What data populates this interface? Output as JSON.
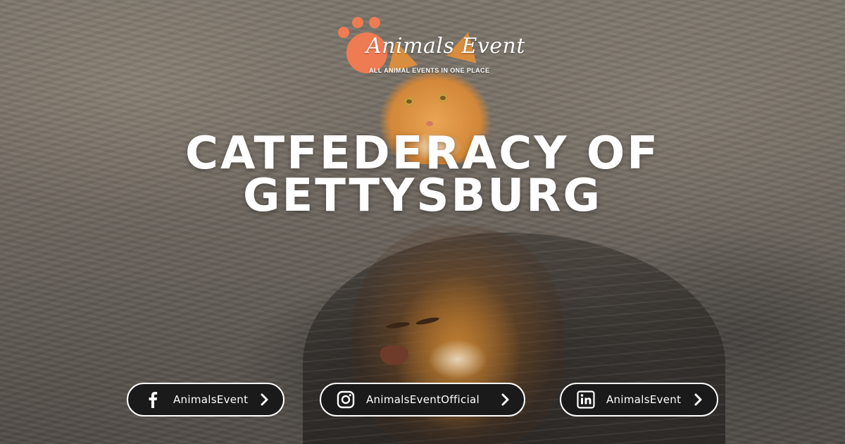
{
  "logo": {
    "title": "Animals Event",
    "tagline": "ALL ANIMAL EVENTS IN ONE PLACE",
    "paw_color": "#ef7b53"
  },
  "headline": {
    "line1": "CATFEDERACY OF",
    "line2": "GETTYSBURG"
  },
  "social": [
    {
      "platform": "facebook",
      "icon": "facebook-icon",
      "handle": "AnimalsEvent"
    },
    {
      "platform": "instagram",
      "icon": "instagram-icon",
      "handle": "AnimalsEventOfficial"
    },
    {
      "platform": "linkedin",
      "icon": "linkedin-icon",
      "handle": "AnimalsEvent"
    }
  ],
  "colors": {
    "pill_background": "#1a1a1a",
    "pill_border": "#ffffff",
    "text": "#ffffff"
  }
}
